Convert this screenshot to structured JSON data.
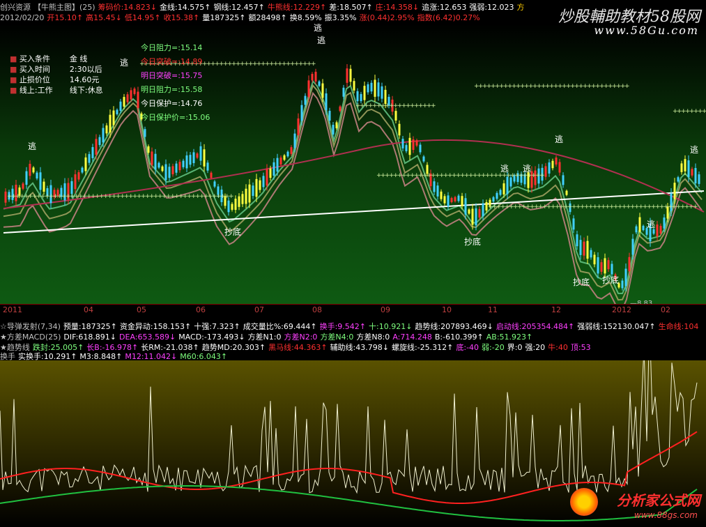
{
  "header": {
    "row1": [
      {
        "t": "创兴资源",
        "c": "#c0c0c0"
      },
      {
        "t": "【牛熊主图】(25)",
        "c": "#c0c0c0"
      },
      {
        "t": "筹码价:14.823↓",
        "c": "#ff3030"
      },
      {
        "t": "金线:14.575↑",
        "c": "#ffffff"
      },
      {
        "t": "钢线:12.457↑",
        "c": "#ffffff"
      },
      {
        "t": "牛熊线:12.229↑",
        "c": "#ff3030"
      },
      {
        "t": "差:18.507↑",
        "c": "#ffffff"
      },
      {
        "t": "庄:14.358↓",
        "c": "#ff3030"
      },
      {
        "t": "追涨:12.653",
        "c": "#ffffff"
      },
      {
        "t": "强弱:12.023",
        "c": "#ffffff"
      },
      {
        "t": "方",
        "c": "#ffcc00"
      }
    ],
    "row2": [
      {
        "t": "2012/02/20",
        "c": "#c0c0c0"
      },
      {
        "t": "开15.10↑",
        "c": "#ff3030"
      },
      {
        "t": "高15.45↓",
        "c": "#ff3030"
      },
      {
        "t": "低14.95↑",
        "c": "#ff3030"
      },
      {
        "t": "收15.38↑",
        "c": "#ff3030"
      },
      {
        "t": "量187325↑",
        "c": "#ffffff"
      },
      {
        "t": "额28498↑",
        "c": "#ffffff"
      },
      {
        "t": "换8.59%",
        "c": "#ffffff"
      },
      {
        "t": "振3.35%",
        "c": "#ffffff"
      },
      {
        "t": "涨(0.44)2.95%",
        "c": "#ff3030"
      },
      {
        "t": "指数(6.42)0.27%",
        "c": "#ff3030"
      }
    ]
  },
  "watermarks": {
    "top": "炒股輔助教材58股网",
    "top_url": "www.58Gu.com",
    "bottom": "分析家公式网",
    "bottom_url": "www.88gs.com"
  },
  "panel_left": {
    "rows": [
      {
        "k": "买入条件",
        "v": "金 线"
      },
      {
        "k": "买入时间",
        "v": "2:30以后"
      },
      {
        "k": "止损价位",
        "v": "14.60元"
      },
      {
        "k": "线上:工作",
        "v": "线下:休息"
      }
    ]
  },
  "panel_right": [
    {
      "t": "今日阻力=:15.14",
      "c": "#7fff7f"
    },
    {
      "t": "今日突破=:14.89",
      "c": "#ff3030"
    },
    {
      "t": "明日突破=:15.75",
      "c": "#ff40ff"
    },
    {
      "t": "明日阻力=:15.58",
      "c": "#7fff7f"
    },
    {
      "t": "今日保护=:14.76",
      "c": "#ffffff"
    },
    {
      "t": "今日保护价=:15.06",
      "c": "#7fff7f"
    }
  ],
  "chart_labels": {
    "escape": "逃",
    "bottom": "抄底",
    "low_price": "8.83"
  },
  "time_axis": [
    "2011",
    "04",
    "05",
    "06",
    "07",
    "08",
    "09",
    "10",
    "11",
    "12",
    "2012",
    "02"
  ],
  "indicator_rows": [
    [
      {
        "t": "☆导弹发射(7,34)",
        "c": "#c0c0c0"
      },
      {
        "t": "预量:187325↑",
        "c": "#ffffff"
      },
      {
        "t": "资金异动:158.153↑",
        "c": "#ffffff"
      },
      {
        "t": "十强:7.323↑",
        "c": "#ffffff"
      },
      {
        "t": "成交量比%:69.444↑",
        "c": "#ffffff"
      },
      {
        "t": "换手:9.542↑",
        "c": "#ff40ff"
      },
      {
        "t": "十:10.921↓",
        "c": "#7fff7f"
      },
      {
        "t": "趋势线:207893.469↓",
        "c": "#ffffff"
      },
      {
        "t": "启动线:205354.484↑",
        "c": "#ff40ff"
      },
      {
        "t": "强弱线:152130.047↑",
        "c": "#ffffff"
      },
      {
        "t": "生命线:104",
        "c": "#ff3030"
      }
    ],
    [
      {
        "t": "★方差MACD(25)",
        "c": "#c0c0c0"
      },
      {
        "t": "DIF:618.891↓",
        "c": "#ffffff"
      },
      {
        "t": "DEA:653.589↓",
        "c": "#ff40ff"
      },
      {
        "t": "MACD:-173.493↓",
        "c": "#ffffff"
      },
      {
        "t": "方差N1:0",
        "c": "#ffffff"
      },
      {
        "t": "方差N2:0",
        "c": "#ff40ff"
      },
      {
        "t": "方差N4:0",
        "c": "#7fff7f"
      },
      {
        "t": "方差N8:0",
        "c": "#ffffff"
      },
      {
        "t": "A:714.248",
        "c": "#ff40ff"
      },
      {
        "t": "B:-610.399↑",
        "c": "#ffffff"
      },
      {
        "t": "AB:51.923↑",
        "c": "#7fff7f"
      }
    ],
    [
      {
        "t": "★趋势线",
        "c": "#c0c0c0"
      },
      {
        "t": "跌封:25.005↑",
        "c": "#7fff7f"
      },
      {
        "t": "长B:-16.978↑",
        "c": "#ff40ff"
      },
      {
        "t": "长RM:-21.038↑",
        "c": "#ffffff"
      },
      {
        "t": "趋势MD:20.303↑",
        "c": "#ffffff"
      },
      {
        "t": "黑马线:44.363↑",
        "c": "#ff3030"
      },
      {
        "t": "辅助线:43.798↓",
        "c": "#ffffff"
      },
      {
        "t": "螺旋线:-25.312↑",
        "c": "#ffffff"
      },
      {
        "t": "底:-40",
        "c": "#ff40ff"
      },
      {
        "t": "弱:-20",
        "c": "#7fff7f"
      },
      {
        "t": "界:0",
        "c": "#ffffff"
      },
      {
        "t": "强:20",
        "c": "#ffffff"
      },
      {
        "t": "牛:40",
        "c": "#ff3030"
      },
      {
        "t": "顶:53",
        "c": "#ff40ff"
      }
    ],
    [
      {
        "t": "换手",
        "c": "#c0c0c0"
      },
      {
        "t": "实换手:10.291↑",
        "c": "#ffffff"
      },
      {
        "t": "M3:8.848↑",
        "c": "#ffffff"
      },
      {
        "t": "M12:11.042↓",
        "c": "#ff40ff"
      },
      {
        "t": "M60:6.043↑",
        "c": "#7fff7f"
      }
    ]
  ],
  "colors": {
    "up": "#ff3030",
    "down": "#40d0ff",
    "yellow": "#ffff40",
    "axis": "#800000"
  }
}
